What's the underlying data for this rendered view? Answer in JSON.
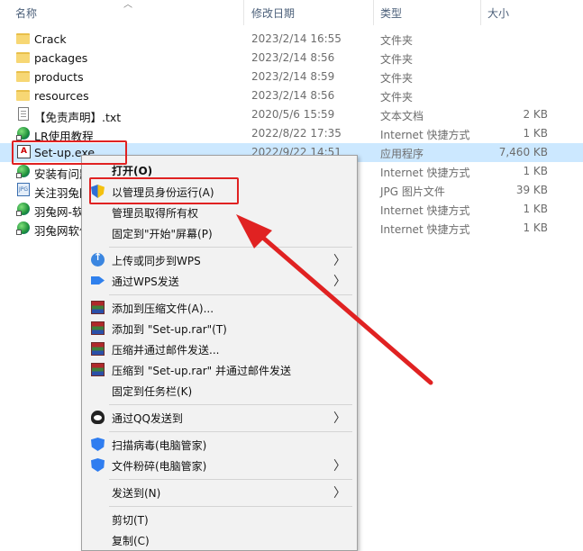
{
  "header": {
    "col_name": "名称",
    "col_date": "修改日期",
    "col_type": "类型",
    "col_size": "大小"
  },
  "files": [
    {
      "name": "Crack",
      "date": "2023/2/14 16:55",
      "type": "文件夹",
      "size": "",
      "icon": "folder-icon"
    },
    {
      "name": "packages",
      "date": "2023/2/14 8:56",
      "type": "文件夹",
      "size": "",
      "icon": "folder-icon"
    },
    {
      "name": "products",
      "date": "2023/2/14 8:59",
      "type": "文件夹",
      "size": "",
      "icon": "folder-icon"
    },
    {
      "name": "resources",
      "date": "2023/2/14 8:56",
      "type": "文件夹",
      "size": "",
      "icon": "folder-icon"
    },
    {
      "name": "【免责声明】.txt",
      "date": "2020/5/6 15:59",
      "type": "文本文档",
      "size": "2 KB",
      "icon": "text-file-icon"
    },
    {
      "name": "LR使用教程",
      "date": "2022/8/22 17:35",
      "type": "Internet 快捷方式",
      "size": "1 KB",
      "icon": "web-shortcut-icon"
    },
    {
      "name": "Set-up.exe",
      "date": "2022/9/22 14:51",
      "type": "应用程序",
      "size": "7,460 KB",
      "icon": "exe-icon"
    },
    {
      "name": "安装有问题",
      "date": "",
      "type": "Internet 快捷方式",
      "size": "1 KB",
      "icon": "web-shortcut-icon"
    },
    {
      "name": "关注羽兔网",
      "date": "",
      "type": "JPG 图片文件",
      "size": "39 KB",
      "icon": "jpg-icon"
    },
    {
      "name": "羽兔网-软",
      "date": "",
      "type": "Internet 快捷方式",
      "size": "1 KB",
      "icon": "web-shortcut-icon"
    },
    {
      "name": "羽兔网软件",
      "date": "",
      "type": "Internet 快捷方式",
      "size": "1 KB",
      "icon": "web-shortcut-icon"
    }
  ],
  "menu": {
    "open": "打开(O)",
    "run_as_admin": "以管理员身份运行(A)",
    "take_ownership": "管理员取得所有权",
    "pin_start": "固定到\"开始\"屏幕(P)",
    "upload_wps": "上传或同步到WPS",
    "send_wps": "通过WPS发送",
    "add_archive": "添加到压缩文件(A)...",
    "add_rar": "添加到 \"Set-up.rar\"(T)",
    "compress_email": "压缩并通过邮件发送...",
    "compress_rar_email": "压缩到 \"Set-up.rar\" 并通过邮件发送",
    "pin_taskbar": "固定到任务栏(K)",
    "send_qq": "通过QQ发送到",
    "scan_virus": "扫描病毒(电脑管家)",
    "shred": "文件粉碎(电脑管家)",
    "send_to": "发送到(N)",
    "cut": "剪切(T)",
    "copy": "复制(C)"
  },
  "colors": {
    "selection": "#cce8ff",
    "annotation": "#e02222",
    "menu_bg": "#f2f2f2"
  }
}
